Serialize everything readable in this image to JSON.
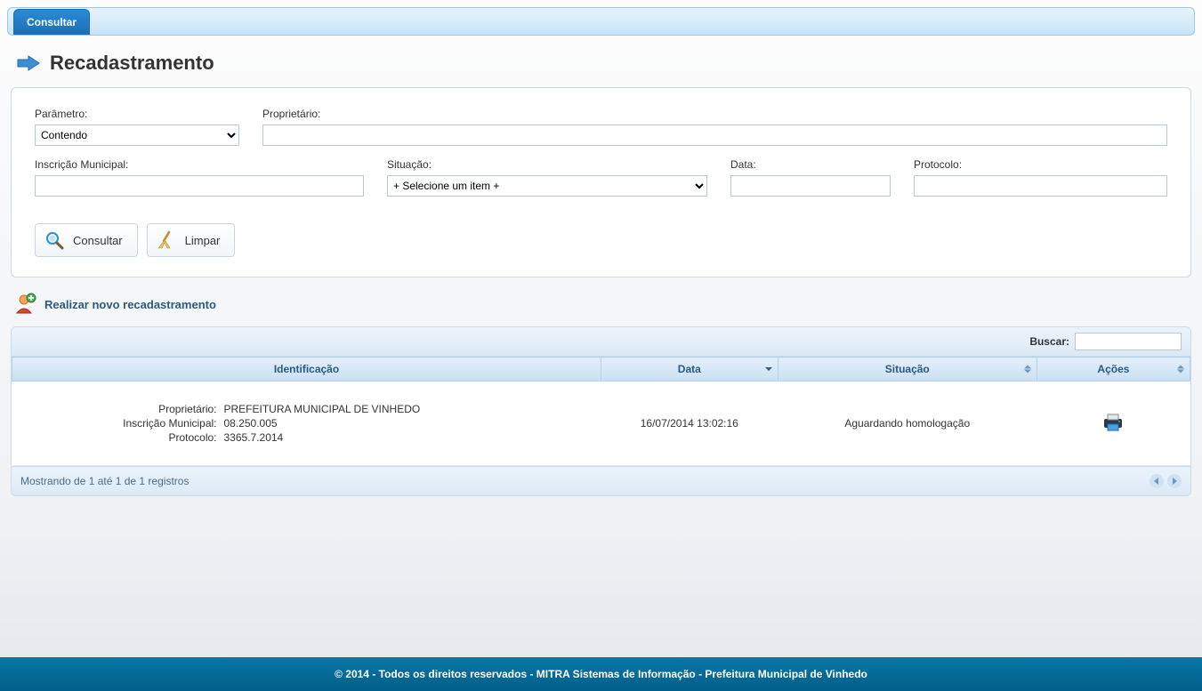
{
  "tabs": {
    "consultar": "Consultar"
  },
  "page_title": "Recadastramento",
  "filters": {
    "parametro": {
      "label": "Parâmetro:",
      "selected": "Contendo"
    },
    "proprietario": {
      "label": "Proprietário:",
      "value": ""
    },
    "inscricao": {
      "label": "Inscrição Municipal:",
      "value": ""
    },
    "situacao": {
      "label": "Situação:",
      "selected": "+ Selecione um item +"
    },
    "data": {
      "label": "Data:",
      "value": ""
    },
    "protocolo": {
      "label": "Protocolo:",
      "value": ""
    }
  },
  "buttons": {
    "consultar": "Consultar",
    "limpar": "Limpar"
  },
  "new_action": "Realizar novo recadastramento",
  "results": {
    "search_label": "Buscar:",
    "search_value": "",
    "columns": {
      "identificacao": "Identificação",
      "data": "Data",
      "situacao": "Situação",
      "acoes": "Ações"
    },
    "rows": [
      {
        "proprietario_label": "Proprietário:",
        "proprietario_val": "PREFEITURA MUNICIPAL DE VINHEDO",
        "inscricao_label": "Inscrição Municipal:",
        "inscricao_val": "08.250.005",
        "protocolo_label": "Protocolo:",
        "protocolo_val": "3365.7.2014",
        "data": "16/07/2014 13:02:16",
        "situacao": "Aguardando homologação"
      }
    ],
    "footer_info": "Mostrando de 1 até 1 de 1 registros"
  },
  "footer": "© 2014 - Todos os direitos reservados - MITRA Sistemas de Informação - Prefeitura Municipal de Vinhedo"
}
